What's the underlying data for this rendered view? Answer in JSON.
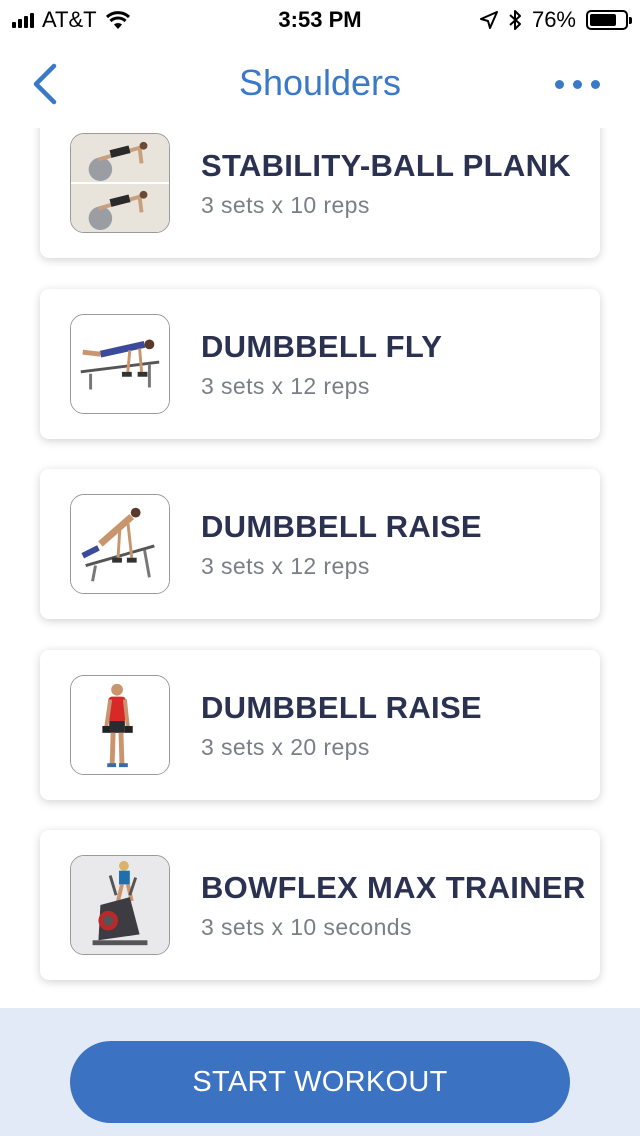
{
  "status_bar": {
    "carrier": "AT&T",
    "time": "3:53 PM",
    "battery_percent": "76%",
    "battery_level": 0.76,
    "icons": [
      "signal-icon",
      "wifi-icon",
      "location-icon",
      "bluetooth-icon",
      "battery-icon"
    ]
  },
  "nav": {
    "title": "Shoulders",
    "back_icon": "chevron-left-icon",
    "more_icon": "more-horizontal-icon"
  },
  "exercises": [
    {
      "name": "STABILITY-BALL PLANK",
      "sets": "3 sets x 10 reps",
      "thumbnail": "stability-ball-plank"
    },
    {
      "name": "DUMBBELL FLY",
      "sets": "3 sets x 12 reps",
      "thumbnail": "dumbbell-fly"
    },
    {
      "name": "DUMBBELL RAISE",
      "sets": "3 sets x 12 reps",
      "thumbnail": "dumbbell-raise-bench"
    },
    {
      "name": "DUMBBELL RAISE",
      "sets": "3 sets x 20 reps",
      "thumbnail": "dumbbell-raise-standing"
    },
    {
      "name": "BOWFLEX MAX TRAINER",
      "sets": "3 sets x 10 seconds",
      "thumbnail": "bowflex-max-trainer"
    }
  ],
  "footer": {
    "start_label": "START WORKOUT"
  },
  "colors": {
    "accent": "#3a78c9",
    "button": "#3b72c1",
    "footer_bg": "#e1eaf6",
    "title_text": "#2b3150",
    "subtitle_text": "#7a7e86"
  }
}
